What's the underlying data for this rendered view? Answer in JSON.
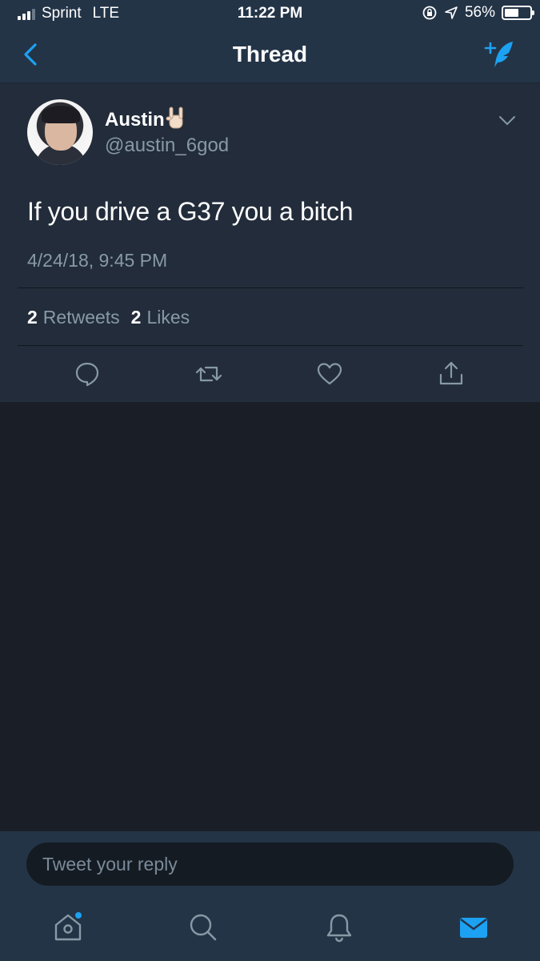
{
  "status_bar": {
    "carrier": "Sprint",
    "network": "LTE",
    "time": "11:22 PM",
    "battery": "56%",
    "battery_level": 0.56,
    "signal_bars": 3
  },
  "nav": {
    "title": "Thread",
    "back_icon": "chevron-left-icon",
    "compose_icon": "compose-tweet-icon"
  },
  "tweet": {
    "display_name": "Austin",
    "name_emoji": "🤘",
    "handle": "@austin_6god",
    "text": "If you drive a G37 you a bitch",
    "timestamp": "4/24/18, 9:45 PM",
    "retweets_count": "2",
    "retweets_label": "Retweets",
    "likes_count": "2",
    "likes_label": "Likes"
  },
  "actions": [
    "reply-icon",
    "retweet-icon",
    "like-icon",
    "share-icon"
  ],
  "reply": {
    "placeholder": "Tweet your reply"
  },
  "tabs": [
    "home-icon",
    "search-icon",
    "notifications-icon",
    "messages-icon"
  ],
  "colors": {
    "accent": "#1da1f2",
    "bar_background": "#243447",
    "card_background": "#222c3a",
    "page_background": "#1a1f27",
    "secondary_text": "#8899a6"
  }
}
